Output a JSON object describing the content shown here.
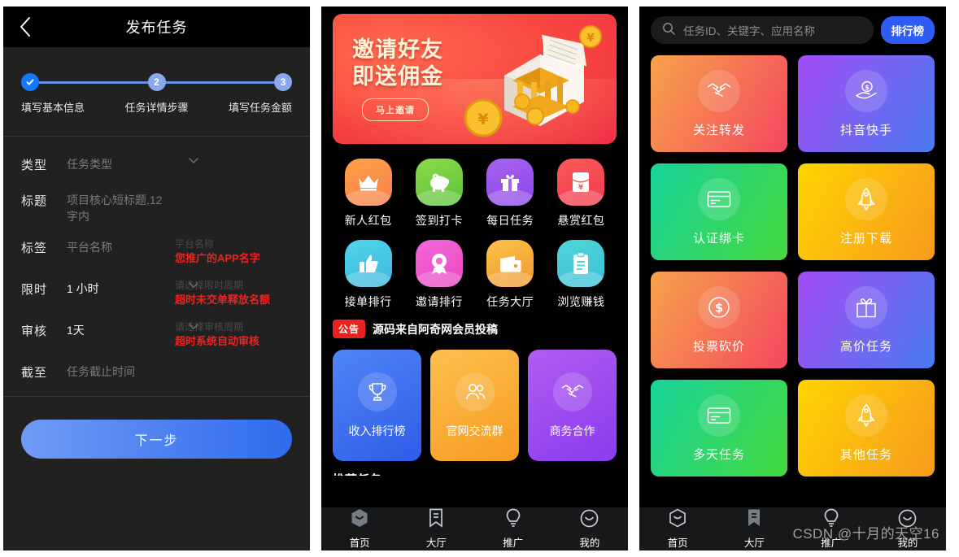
{
  "publish": {
    "header": {
      "title": "发布任务",
      "back_icon": "chevron-left-icon"
    },
    "steps": [
      {
        "marker": "✓",
        "label": "填写基本信息",
        "state": "done"
      },
      {
        "marker": "2",
        "label": "任务详情步骤",
        "state": "pending"
      },
      {
        "marker": "3",
        "label": "填写任务金额",
        "state": "pending"
      }
    ],
    "fields": [
      {
        "label": "类型",
        "value": "",
        "placeholder": "任务类型",
        "has_chevron": true,
        "hint_gray": "",
        "hint_red": ""
      },
      {
        "label": "标题",
        "value": "",
        "placeholder": "项目核心短标题,12字内",
        "has_chevron": false,
        "hint_gray": "",
        "hint_red": ""
      },
      {
        "label": "标签",
        "value": "",
        "placeholder": "平台名称",
        "has_chevron": false,
        "hint_gray": "平台名称",
        "hint_red": "您推广的APP名字"
      },
      {
        "label": "限时",
        "value": "1 小时",
        "placeholder": "",
        "has_chevron": true,
        "hint_gray": "请选择限时周期",
        "hint_red": "超时未交单释放名额"
      },
      {
        "label": "审核",
        "value": "1天",
        "placeholder": "",
        "has_chevron": true,
        "hint_gray": "请选择审核周期",
        "hint_red": "超时系统自动审核"
      },
      {
        "label": "截至",
        "value": "",
        "placeholder": "任务截止时间",
        "has_chevron": false,
        "hint_gray": "",
        "hint_red": ""
      }
    ],
    "next_button": "下一步"
  },
  "home": {
    "banner": {
      "line1": "邀请好友",
      "line2": "即送佣金",
      "cta": "马上邀请",
      "art_icon": "treasure-book-coins-art"
    },
    "icons": [
      {
        "label": "新人红包",
        "icon": "crown-icon",
        "c1": "#ffa34a",
        "c2": "#f97d46"
      },
      {
        "label": "签到打卡",
        "icon": "piggy-bank-icon",
        "c1": "#8ed94a",
        "c2": "#5cc23c"
      },
      {
        "label": "每日任务",
        "icon": "gift-icon",
        "c1": "#a764f0",
        "c2": "#8b46e8"
      },
      {
        "label": "悬赏红包",
        "icon": "red-envelope-icon",
        "c1": "#fa5a5a",
        "c2": "#f03b4d"
      },
      {
        "label": "接单排行",
        "icon": "thumbs-up-icon",
        "c1": "#4fd6e8",
        "c2": "#3cb6e0"
      },
      {
        "label": "邀请排行",
        "icon": "medal-icon",
        "c1": "#f368d8",
        "c2": "#e948c0"
      },
      {
        "label": "任务大厅",
        "icon": "wallet-icon",
        "c1": "#fcc14a",
        "c2": "#f0992e"
      },
      {
        "label": "浏览赚钱",
        "icon": "clipboard-icon",
        "c1": "#4fd6d8",
        "c2": "#3cc0d8"
      }
    ],
    "notice": {
      "tag": "公告",
      "text": "源码来自阿奇网会员投稿"
    },
    "promos": [
      {
        "label": "收入排行榜",
        "icon": "trophy-icon",
        "c1": "#4f86f7",
        "c2": "#2f5ce8"
      },
      {
        "label": "官网交流群",
        "icon": "users-icon",
        "c1": "#fdc04e",
        "c2": "#f79a22"
      },
      {
        "label": "商务合作",
        "icon": "handshake-icon",
        "c1": "#b15cf0",
        "c2": "#8a3cf0"
      }
    ],
    "section_cut_title": "推荐任务",
    "tabs": [
      {
        "label": "首页",
        "icon": "home-hex-icon",
        "active": true
      },
      {
        "label": "大厅",
        "icon": "bookmark-icon",
        "active": false
      },
      {
        "label": "推广",
        "icon": "bulb-icon",
        "active": false
      },
      {
        "label": "我的",
        "icon": "smiley-icon",
        "active": false
      }
    ]
  },
  "hall": {
    "search": {
      "placeholder": "任务ID、关键字、应用名称",
      "icon": "search-icon"
    },
    "rank_button": "排行榜",
    "cards": [
      {
        "label": "关注转发",
        "icon": "handshake-icon",
        "c1": "#f7a24a",
        "c2": "#f4475f"
      },
      {
        "label": "抖音快手",
        "icon": "hand-coin-icon",
        "c1": "#a34cf5",
        "c2": "#4a7cf0"
      },
      {
        "label": "认证绑卡",
        "icon": "bank-card-icon",
        "c1": "#18d39a",
        "c2": "#45d93c"
      },
      {
        "label": "注册下载",
        "icon": "rocket-icon",
        "c1": "#ffd400",
        "c2": "#f79a1e"
      },
      {
        "label": "投票砍价",
        "icon": "dollar-coin-icon",
        "c1": "#f7a24a",
        "c2": "#f4475f"
      },
      {
        "label": "高价任务",
        "icon": "gift-icon",
        "c1": "#a34cf5",
        "c2": "#4a7cf0"
      },
      {
        "label": "多天任务",
        "icon": "bank-card-icon",
        "c1": "#18d39a",
        "c2": "#45d93c"
      },
      {
        "label": "其他任务",
        "icon": "rocket-icon",
        "c1": "#ffd400",
        "c2": "#f79a1e"
      }
    ],
    "tabs": [
      {
        "label": "首页",
        "icon": "home-hex-icon",
        "active": false
      },
      {
        "label": "大厅",
        "icon": "bookmark-icon",
        "active": true
      },
      {
        "label": "推广",
        "icon": "bulb-icon",
        "active": false
      },
      {
        "label": "我的",
        "icon": "smiley-icon",
        "active": false
      }
    ],
    "watermark": "CSDN @十月的天空16"
  }
}
